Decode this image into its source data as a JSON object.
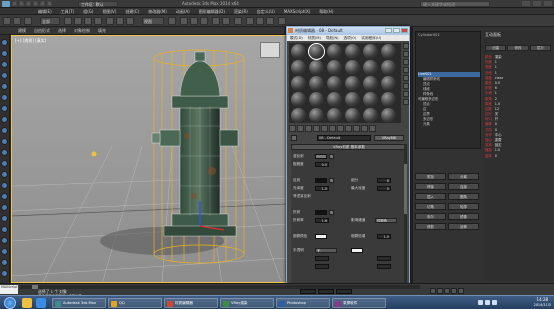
{
  "titlebar": {
    "workspace": "工作区: 默认",
    "title": "Autodesk 3ds Max 2014 x64",
    "search_placeholder": "键入关键字或短语"
  },
  "menubar": {
    "items": [
      "编辑(E)",
      "工具(T)",
      "组(G)",
      "视图(V)",
      "创建(C)",
      "修改器(M)",
      "动画(A)",
      "图形编辑器(D)",
      "渲染(R)",
      "自定义(U)",
      "MAXScript(X)",
      "帮助(H)"
    ]
  },
  "toolbar": {
    "selection_filter": "全部",
    "ref_coord": "视图"
  },
  "ribbon": {
    "tabs": [
      "建模",
      "自由形式",
      "选择",
      "对象绘制",
      "填充"
    ]
  },
  "viewport": {
    "label": "[+] [透视] [真实]"
  },
  "material_editor": {
    "title": "材质编辑器 - 08 - Default",
    "menu": [
      "模式(D)",
      "材质(M)",
      "导航(N)",
      "选项(O)",
      "实用程序(U)"
    ],
    "material_name": "08 - Default",
    "material_type": "VRayMtl",
    "rollout_basic": "VRay材质 基本参数",
    "diffuse_label": "漫反射",
    "roughness_label": "粗糙度",
    "roughness_value": "0.0",
    "reflect_label": "反射",
    "gloss_label": "光泽度",
    "gloss_value": "1.0",
    "fresnel_label": "菲涅耳反射",
    "subdivs_label": "细分",
    "subdivs_value": "8",
    "max_depth_label": "最大深度",
    "max_depth_value": "5",
    "refract_label": "折射",
    "ior_label": "折射率",
    "ior_value": "1.6",
    "affect_label": "影响通道",
    "affect_value": "仅颜色",
    "fog_label": "烟雾颜色",
    "fog_mult_label": "烟雾倍增",
    "fog_mult_value": "1.0",
    "translucency_label": "半透明",
    "translucency_value": "无"
  },
  "command_panel": {
    "scene_header": "Cylinder001",
    "scene_items": [
      "Line001",
      "编辑样条线",
      "顶点",
      "线段",
      "样条线",
      "可编辑多边形",
      "顶点",
      "边",
      "边界",
      "多边形",
      "元素"
    ],
    "selected_index": 0,
    "panel_title": "互动面板",
    "tabs": [
      "创建",
      "修改",
      "层次"
    ],
    "rows": [
      {
        "k": "颜色",
        "v": "渲染"
      },
      {
        "k": "长度",
        "v": "1"
      },
      {
        "k": "宽度",
        "v": "1"
      },
      {
        "k": "分段",
        "v": "1"
      },
      {
        "k": "高度",
        "v": "clear"
      },
      {
        "k": "角度",
        "v": "0.0"
      },
      {
        "k": "步数",
        "v": "6"
      },
      {
        "k": "平滑",
        "v": "1"
      },
      {
        "k": "倒角",
        "v": "2"
      },
      {
        "k": "厚度",
        "v": "1.0"
      },
      {
        "k": "边数",
        "v": "12"
      },
      {
        "k": "切片",
        "v": "关"
      },
      {
        "k": "封口",
        "v": "开"
      },
      {
        "k": "偏移",
        "v": "0"
      },
      {
        "k": "方向",
        "v": "X"
      },
      {
        "k": "对齐",
        "v": "中心"
      },
      {
        "k": "轴心",
        "v": "重置"
      },
      {
        "k": "变换",
        "v": "锁定"
      },
      {
        "k": "缩放",
        "v": "1.0"
      },
      {
        "k": "旋转",
        "v": "0"
      }
    ],
    "buttons": [
      "附加",
      "分离",
      "焊接",
      "连接",
      "插入",
      "圆角",
      "切角",
      "轮廓",
      "布尔",
      "镜像",
      "修剪",
      "延伸"
    ]
  },
  "statusbar": {
    "cmd": "MAXScript 侦听器",
    "msg1": "选择了 1 个 对象",
    "msg2": "单击或单击并拖动以选择对象",
    "frame": "0 / 100"
  },
  "taskbar": {
    "tasks": [
      {
        "label": "Autodesk 3ds Max",
        "color": "#3a8d8d"
      },
      {
        "label": "QQ",
        "color": "#e8a020"
      },
      {
        "label": "材质编辑器",
        "color": "#d04a30"
      },
      {
        "label": "VRay渲染",
        "color": "#3a8d3a"
      },
      {
        "label": "Photoshop",
        "color": "#2a5fa8"
      },
      {
        "label": "录屏软件",
        "color": "#8a3a8a"
      }
    ],
    "time": "14:28",
    "date": "2014/11/5"
  }
}
